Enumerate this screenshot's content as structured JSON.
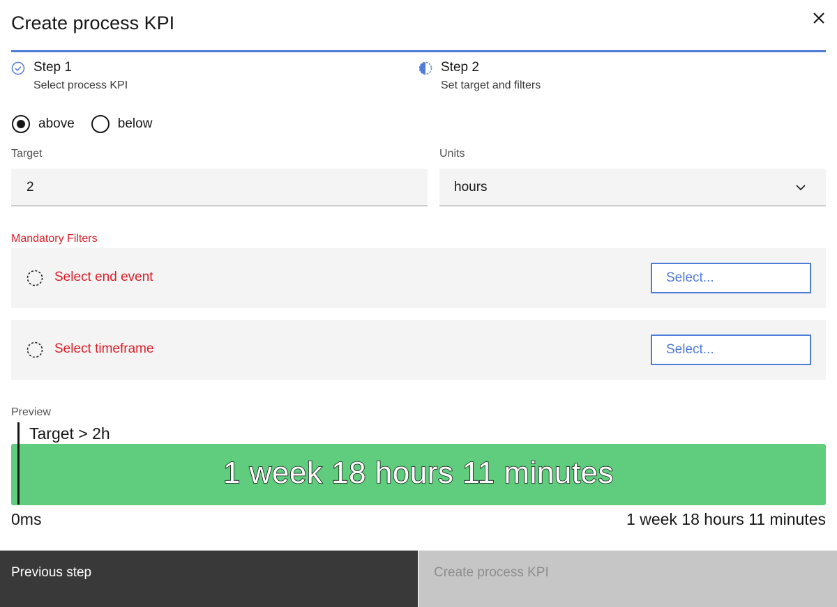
{
  "modal": {
    "title": "Create process KPI",
    "close_icon": "close-icon"
  },
  "steps": [
    {
      "title": "Step 1",
      "subtitle": "Select process KPI",
      "status": "complete",
      "icon": "checkmark-outline-icon"
    },
    {
      "title": "Step 2",
      "subtitle": "Set target and filters",
      "status": "current",
      "icon": "incomplete-half-icon"
    }
  ],
  "comparison": {
    "options": [
      {
        "label": "above",
        "selected": true
      },
      {
        "label": "below",
        "selected": false
      }
    ]
  },
  "target": {
    "label": "Target",
    "value": "2"
  },
  "units": {
    "label": "Units",
    "value": "hours",
    "icon": "chevron-down-icon"
  },
  "filters": {
    "title": "Mandatory Filters",
    "items": [
      {
        "label": "Select end event",
        "button": "Select...",
        "icon": "incomplete-dashed-circle-icon"
      },
      {
        "label": "Select timeframe",
        "button": "Select...",
        "icon": "incomplete-dashed-circle-icon"
      }
    ]
  },
  "preview": {
    "label": "Preview",
    "target_text": "Target > 2h",
    "bar_text": "1 week 18 hours 11 minutes",
    "axis_min": "0ms",
    "axis_max": "1 week 18 hours 11 minutes",
    "bar_color": "#5fcd7d"
  },
  "footer": {
    "previous": "Previous step",
    "create": "Create process KPI"
  },
  "colors": {
    "accent": "#4f7bd9",
    "error": "#da1e28",
    "primary_button": "#393939",
    "disabled_button": "#c6c6c6"
  }
}
